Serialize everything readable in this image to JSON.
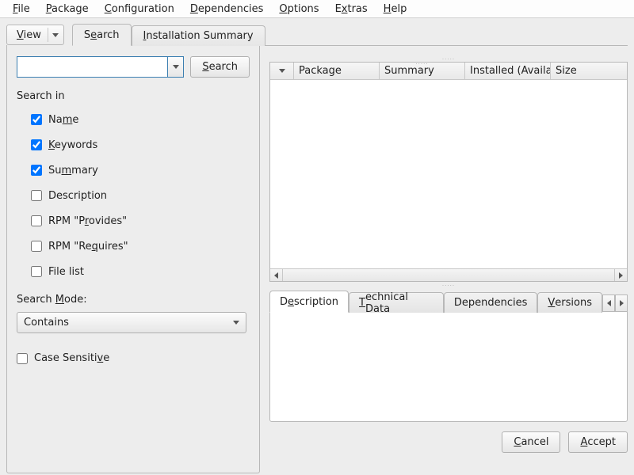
{
  "menubar": {
    "file": "File",
    "package": "Package",
    "configuration": "Configuration",
    "dependencies": "Dependencies",
    "options": "Options",
    "extras": "Extras",
    "help": "Help"
  },
  "view_button": "View",
  "tabs": {
    "search": "Search",
    "install_summary": "Installation Summary"
  },
  "search_panel": {
    "search_value": "",
    "search_button": "Search",
    "search_in_label": "Search in",
    "fields": {
      "name": "Name",
      "keywords": "Keywords",
      "summary": "Summary",
      "description": "Description",
      "provides": "RPM \"Provides\"",
      "requires": "RPM \"Requires\"",
      "file_list": "File list"
    },
    "mode_label": "Search Mode:",
    "mode_value": "Contains",
    "case_sensitive": "Case Sensitive"
  },
  "table": {
    "columns": {
      "package": "Package",
      "summary": "Summary",
      "installed": "Installed (Available)",
      "size": "Size"
    }
  },
  "detail_tabs": {
    "description": "Description",
    "technical": "Technical Data",
    "dependencies": "Dependencies",
    "versions": "Versions"
  },
  "buttons": {
    "cancel": "Cancel",
    "accept": "Accept"
  }
}
